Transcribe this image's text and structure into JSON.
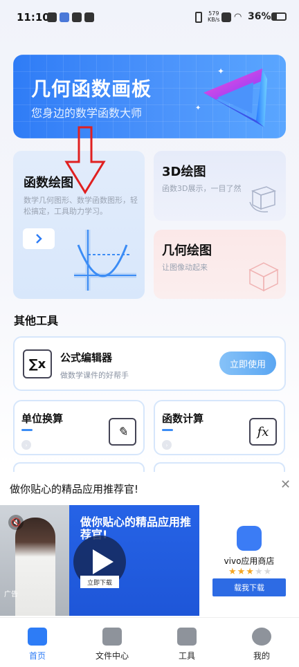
{
  "status_bar": {
    "time": "11:10",
    "net_speed": "579",
    "net_unit": "KB/s",
    "battery": "36%"
  },
  "banner": {
    "title": "几何函数画板",
    "subtitle": "您身边的数学函数大师"
  },
  "features": {
    "graph": {
      "title": "函数绘图",
      "desc": "数学几何图形、数学函数图形，轻松搞定，工具助力学习。"
    },
    "three_d": {
      "title": "3D绘图",
      "desc": "函数3D展示，一目了然"
    },
    "geometry": {
      "title": "几何绘图",
      "desc": "让图像动起来"
    }
  },
  "other_tools": {
    "section_title": "其他工具",
    "formula": {
      "title": "公式编辑器",
      "desc": "做数学课件的好帮手",
      "button": "立即使用",
      "icon_text": "∑x"
    },
    "unit": {
      "title": "单位换算"
    },
    "calc": {
      "title": "函数计算",
      "icon_text": "fx"
    }
  },
  "ad": {
    "title": "做你贴心的精品应用推荐官!",
    "video_tag": "广告",
    "video_headline": "做你贴心的精品应用推荐官!",
    "video_button": "立即下载",
    "app_name": "vivo应用商店",
    "stars": "★★★★★",
    "app_button": "载我下载"
  },
  "nav": {
    "items": [
      {
        "label": "首页"
      },
      {
        "label": "文件中心"
      },
      {
        "label": "工具"
      },
      {
        "label": "我的"
      }
    ]
  }
}
